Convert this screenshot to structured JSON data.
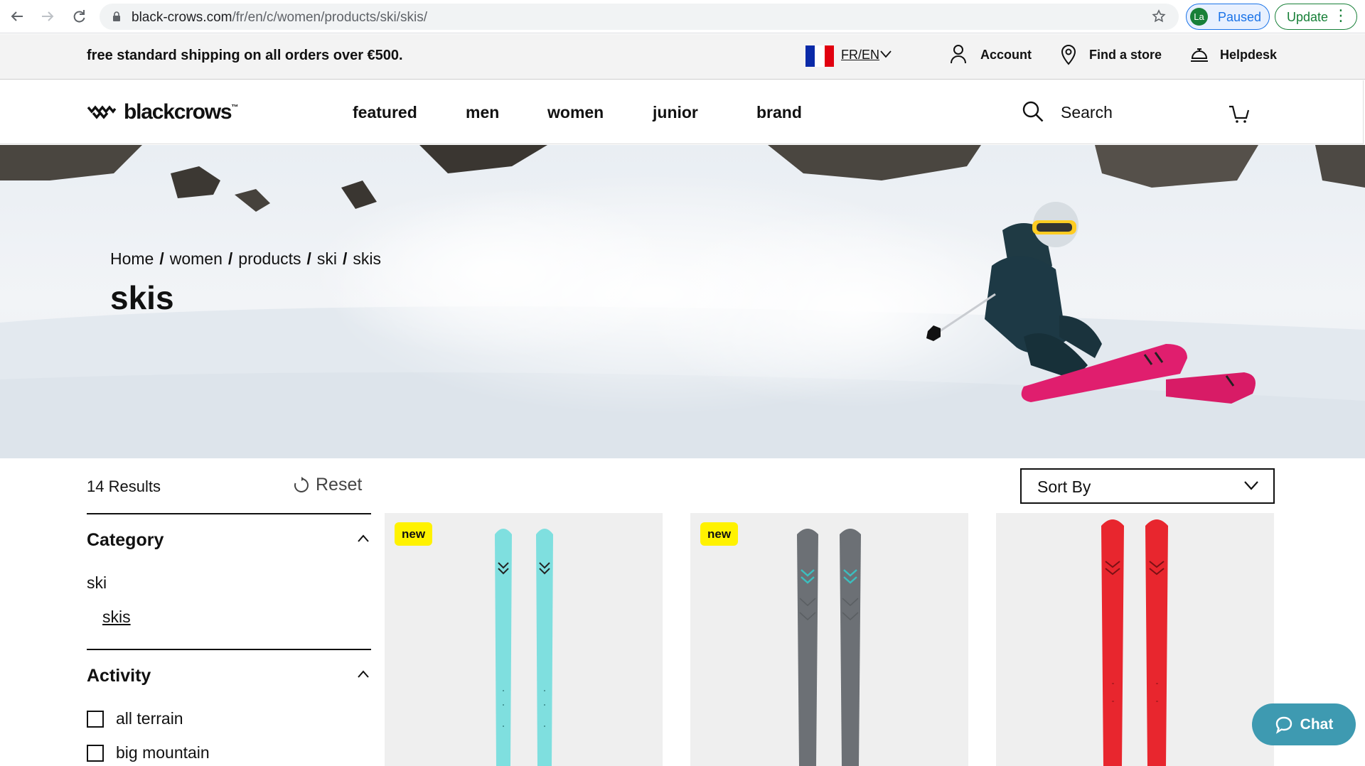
{
  "browser": {
    "url_host": "black-crows.com",
    "url_path": "/fr/en/c/women/products/ski/skis/",
    "profile_initials": "La",
    "profile_status": "Paused",
    "update_label": "Update"
  },
  "utility_bar": {
    "shipping_text": "free standard shipping on all orders over €500.",
    "language": "FR/EN",
    "account_label": "Account",
    "find_store_label": "Find a store",
    "helpdesk_label": "Helpdesk",
    "flag_colors": [
      "#0a2aa8",
      "#ffffff",
      "#e1000f"
    ]
  },
  "header": {
    "logo_text": "blackcrows",
    "logo_tm": "™",
    "nav": [
      "featured",
      "men",
      "women",
      "junior",
      "brand"
    ],
    "search_label": "Search"
  },
  "hero": {
    "breadcrumb": [
      "Home",
      "women",
      "products",
      "ski",
      "skis"
    ],
    "breadcrumb_separator": "/",
    "title": "skis"
  },
  "listing": {
    "results_count": "14 Results",
    "reset_label": "Reset",
    "sort_label": "Sort By",
    "filters": {
      "category": {
        "title": "Category",
        "parent": "ski",
        "child": "skis"
      },
      "activity": {
        "title": "Activity",
        "options": [
          "all terrain",
          "big mountain"
        ]
      }
    },
    "products": [
      {
        "badge": "new",
        "ski_color": "#7fdfdf",
        "accent_color": "#222222"
      },
      {
        "badge": "new",
        "ski_color": "#6c7075",
        "accent_color": "#3bbfbf"
      },
      {
        "badge": "",
        "ski_color": "#e8262e",
        "accent_color": "#222222"
      }
    ]
  },
  "chat": {
    "label": "Chat"
  },
  "colors": {
    "badge": "#fff200",
    "chat": "#3e9ab1",
    "accent_ski": "#e01e6e"
  }
}
